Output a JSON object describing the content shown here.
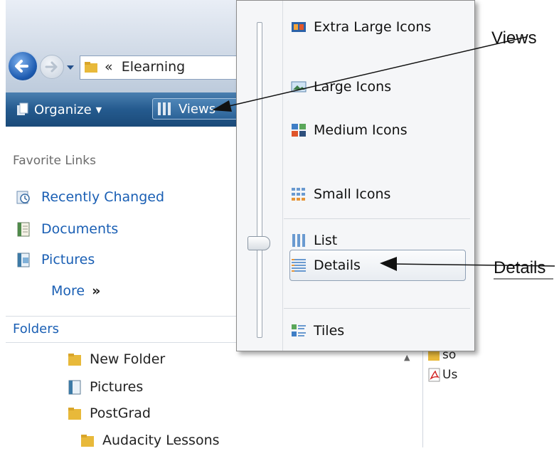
{
  "address": {
    "chevron": "«",
    "path": "Elearning"
  },
  "toolbar": {
    "organize_label": "Organize",
    "organize_arrow": "▼",
    "views_label": "Views"
  },
  "favorites": {
    "title": "Favorite Links",
    "links": [
      {
        "label": "Recently Changed",
        "icon": "recently-changed-icon"
      },
      {
        "label": "Documents",
        "icon": "documents-icon"
      },
      {
        "label": "Pictures",
        "icon": "pictures-icon"
      }
    ],
    "more_label": "More",
    "more_arrow": "»"
  },
  "folders": {
    "title": "Folders",
    "items": [
      {
        "label": "New Folder",
        "icon": "folder-icon"
      },
      {
        "label": "Pictures",
        "icon": "pictures-icon"
      },
      {
        "label": "PostGrad",
        "icon": "folder-icon"
      },
      {
        "label": "Audacity Lessons",
        "icon": "folder-icon"
      }
    ]
  },
  "files": [
    {
      "label": "so"
    },
    {
      "label": "Us"
    }
  ],
  "views_menu": {
    "items": [
      {
        "label": "Extra Large Icons"
      },
      {
        "label": "Large Icons"
      },
      {
        "label": "Medium Icons"
      },
      {
        "label": "Small Icons"
      },
      {
        "label": "List"
      },
      {
        "label": "Details",
        "selected": true
      },
      {
        "label": "Tiles"
      }
    ]
  },
  "annotations": {
    "views": "Views",
    "details": "Details"
  },
  "colors": {
    "toolbar": "#245a8e",
    "link": "#1a5fb4",
    "menu_bg": "#f5f6f8"
  }
}
